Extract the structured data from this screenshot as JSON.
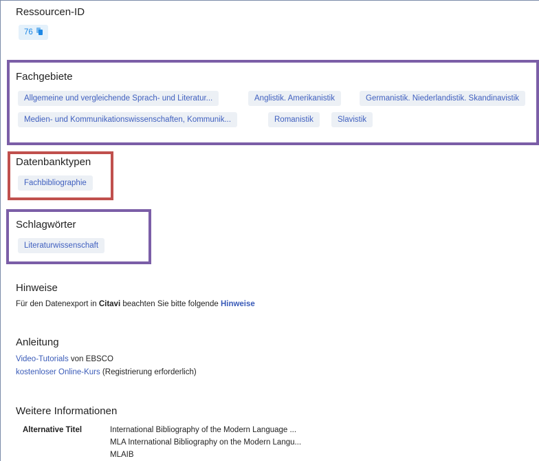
{
  "resource_id": {
    "title": "Ressourcen-ID",
    "value": "76",
    "copy_icon": "copy-icon"
  },
  "fachgebiete": {
    "title": "Fachgebiete",
    "chips": [
      "Allgemeine und vergleichende Sprach- und Literatur...",
      "Anglistik. Amerikanistik",
      "Germanistik. Niederlandistik. Skandinavistik",
      "Medien- und Kommunikationswissenschaften, Kommunik...",
      "Romanistik",
      "Slavistik"
    ]
  },
  "datenbanktypen": {
    "title": "Datenbanktypen",
    "chips": [
      "Fachbibliographie"
    ]
  },
  "schlagwoerter": {
    "title": "Schlagwörter",
    "chips": [
      "Literaturwissenschaft"
    ]
  },
  "hinweise": {
    "title": "Hinweise",
    "text_before": "Für den Datenexport in ",
    "bold": "Citavi",
    "text_middle": " beachten Sie bitte folgende ",
    "link": "Hinweise"
  },
  "anleitung": {
    "title": "Anleitung",
    "line1_link": "Video-Tutorials",
    "line1_text": " von EBSCO",
    "line2_link": "kostenloser Online-Kurs",
    "line2_text": " (Registrierung erforderlich)"
  },
  "weitere": {
    "title": "Weitere Informationen",
    "label": "Alternative Titel",
    "values": [
      "International Bibliography of the Modern Language ...",
      "MLA International Bibliography on the Modern Langu...",
      "MLAIB"
    ]
  },
  "colors": {
    "annotation_purple": "#7b5ea7",
    "annotation_red": "#c0504d",
    "chip_bg": "#ecf0f5",
    "chip_text": "#3f5fbf",
    "id_chip_bg": "#e4f1fb",
    "id_chip_text": "#1e88e5"
  }
}
